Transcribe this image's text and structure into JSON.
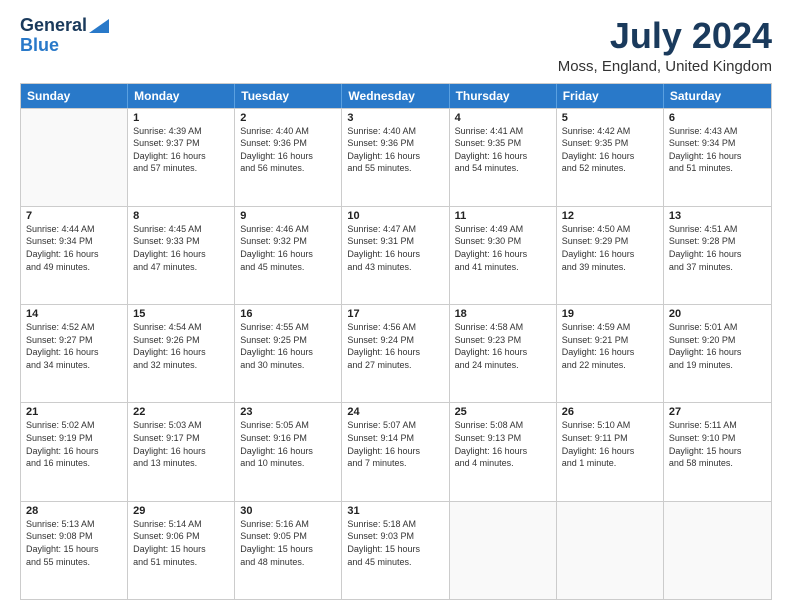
{
  "logo": {
    "line1": "General",
    "line2": "Blue"
  },
  "title": "July 2024",
  "subtitle": "Moss, England, United Kingdom",
  "headers": [
    "Sunday",
    "Monday",
    "Tuesday",
    "Wednesday",
    "Thursday",
    "Friday",
    "Saturday"
  ],
  "weeks": [
    [
      {
        "day": "",
        "info": ""
      },
      {
        "day": "1",
        "info": "Sunrise: 4:39 AM\nSunset: 9:37 PM\nDaylight: 16 hours\nand 57 minutes."
      },
      {
        "day": "2",
        "info": "Sunrise: 4:40 AM\nSunset: 9:36 PM\nDaylight: 16 hours\nand 56 minutes."
      },
      {
        "day": "3",
        "info": "Sunrise: 4:40 AM\nSunset: 9:36 PM\nDaylight: 16 hours\nand 55 minutes."
      },
      {
        "day": "4",
        "info": "Sunrise: 4:41 AM\nSunset: 9:35 PM\nDaylight: 16 hours\nand 54 minutes."
      },
      {
        "day": "5",
        "info": "Sunrise: 4:42 AM\nSunset: 9:35 PM\nDaylight: 16 hours\nand 52 minutes."
      },
      {
        "day": "6",
        "info": "Sunrise: 4:43 AM\nSunset: 9:34 PM\nDaylight: 16 hours\nand 51 minutes."
      }
    ],
    [
      {
        "day": "7",
        "info": "Sunrise: 4:44 AM\nSunset: 9:34 PM\nDaylight: 16 hours\nand 49 minutes."
      },
      {
        "day": "8",
        "info": "Sunrise: 4:45 AM\nSunset: 9:33 PM\nDaylight: 16 hours\nand 47 minutes."
      },
      {
        "day": "9",
        "info": "Sunrise: 4:46 AM\nSunset: 9:32 PM\nDaylight: 16 hours\nand 45 minutes."
      },
      {
        "day": "10",
        "info": "Sunrise: 4:47 AM\nSunset: 9:31 PM\nDaylight: 16 hours\nand 43 minutes."
      },
      {
        "day": "11",
        "info": "Sunrise: 4:49 AM\nSunset: 9:30 PM\nDaylight: 16 hours\nand 41 minutes."
      },
      {
        "day": "12",
        "info": "Sunrise: 4:50 AM\nSunset: 9:29 PM\nDaylight: 16 hours\nand 39 minutes."
      },
      {
        "day": "13",
        "info": "Sunrise: 4:51 AM\nSunset: 9:28 PM\nDaylight: 16 hours\nand 37 minutes."
      }
    ],
    [
      {
        "day": "14",
        "info": "Sunrise: 4:52 AM\nSunset: 9:27 PM\nDaylight: 16 hours\nand 34 minutes."
      },
      {
        "day": "15",
        "info": "Sunrise: 4:54 AM\nSunset: 9:26 PM\nDaylight: 16 hours\nand 32 minutes."
      },
      {
        "day": "16",
        "info": "Sunrise: 4:55 AM\nSunset: 9:25 PM\nDaylight: 16 hours\nand 30 minutes."
      },
      {
        "day": "17",
        "info": "Sunrise: 4:56 AM\nSunset: 9:24 PM\nDaylight: 16 hours\nand 27 minutes."
      },
      {
        "day": "18",
        "info": "Sunrise: 4:58 AM\nSunset: 9:23 PM\nDaylight: 16 hours\nand 24 minutes."
      },
      {
        "day": "19",
        "info": "Sunrise: 4:59 AM\nSunset: 9:21 PM\nDaylight: 16 hours\nand 22 minutes."
      },
      {
        "day": "20",
        "info": "Sunrise: 5:01 AM\nSunset: 9:20 PM\nDaylight: 16 hours\nand 19 minutes."
      }
    ],
    [
      {
        "day": "21",
        "info": "Sunrise: 5:02 AM\nSunset: 9:19 PM\nDaylight: 16 hours\nand 16 minutes."
      },
      {
        "day": "22",
        "info": "Sunrise: 5:03 AM\nSunset: 9:17 PM\nDaylight: 16 hours\nand 13 minutes."
      },
      {
        "day": "23",
        "info": "Sunrise: 5:05 AM\nSunset: 9:16 PM\nDaylight: 16 hours\nand 10 minutes."
      },
      {
        "day": "24",
        "info": "Sunrise: 5:07 AM\nSunset: 9:14 PM\nDaylight: 16 hours\nand 7 minutes."
      },
      {
        "day": "25",
        "info": "Sunrise: 5:08 AM\nSunset: 9:13 PM\nDaylight: 16 hours\nand 4 minutes."
      },
      {
        "day": "26",
        "info": "Sunrise: 5:10 AM\nSunset: 9:11 PM\nDaylight: 16 hours\nand 1 minute."
      },
      {
        "day": "27",
        "info": "Sunrise: 5:11 AM\nSunset: 9:10 PM\nDaylight: 15 hours\nand 58 minutes."
      }
    ],
    [
      {
        "day": "28",
        "info": "Sunrise: 5:13 AM\nSunset: 9:08 PM\nDaylight: 15 hours\nand 55 minutes."
      },
      {
        "day": "29",
        "info": "Sunrise: 5:14 AM\nSunset: 9:06 PM\nDaylight: 15 hours\nand 51 minutes."
      },
      {
        "day": "30",
        "info": "Sunrise: 5:16 AM\nSunset: 9:05 PM\nDaylight: 15 hours\nand 48 minutes."
      },
      {
        "day": "31",
        "info": "Sunrise: 5:18 AM\nSunset: 9:03 PM\nDaylight: 15 hours\nand 45 minutes."
      },
      {
        "day": "",
        "info": ""
      },
      {
        "day": "",
        "info": ""
      },
      {
        "day": "",
        "info": ""
      }
    ]
  ]
}
